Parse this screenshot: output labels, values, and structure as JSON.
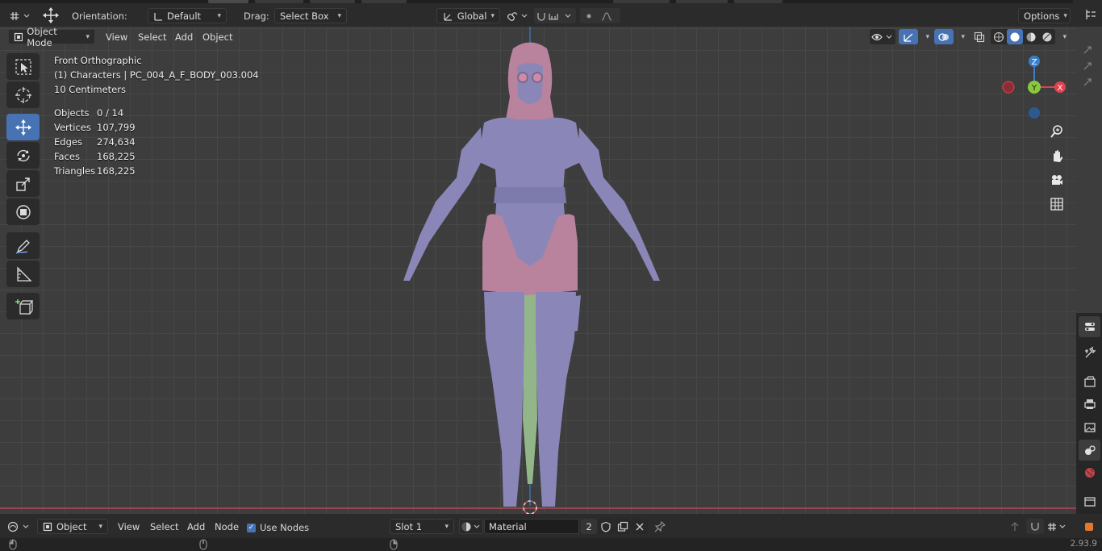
{
  "tool_settings": {
    "orientation_label": "Orientation:",
    "orientation_value": "Default",
    "drag_label": "Drag:",
    "drag_value": "Select Box",
    "transform_orientation": "Global",
    "options_label": "Options"
  },
  "viewport_header": {
    "mode": "Object Mode",
    "menus": [
      "View",
      "Select",
      "Add",
      "Object"
    ]
  },
  "overlay": {
    "view_name": "Front Orthographic",
    "collection_object": "(1) Characters | PC_004_A_F_BODY_003.004",
    "scale": "10 Centimeters",
    "stats": [
      {
        "key": "Objects",
        "value": "0 / 14"
      },
      {
        "key": "Vertices",
        "value": "107,799"
      },
      {
        "key": "Edges",
        "value": "274,634"
      },
      {
        "key": "Faces",
        "value": "168,225"
      },
      {
        "key": "Triangles",
        "value": "168,225"
      }
    ]
  },
  "gizmo": {
    "z": "Z",
    "y": "Y",
    "x": "X"
  },
  "shader_bar": {
    "object_type": "Object",
    "menus": [
      "View",
      "Select",
      "Add",
      "Node"
    ],
    "use_nodes_label": "Use Nodes",
    "slot": "Slot 1",
    "material_name": "Material",
    "users": "2"
  },
  "status": {
    "version": "2.93.9"
  },
  "colors": {
    "accent": "#4772b3",
    "viewport_bg": "#3d3d3d",
    "grid": "#474747",
    "axis_x": "#e0434f",
    "axis_y": "#8ac83c",
    "axis_z": "#3c7ec8",
    "mesh_body": "#8a87b8",
    "mesh_pink": "#b9839e",
    "mesh_green": "#93b58a"
  }
}
